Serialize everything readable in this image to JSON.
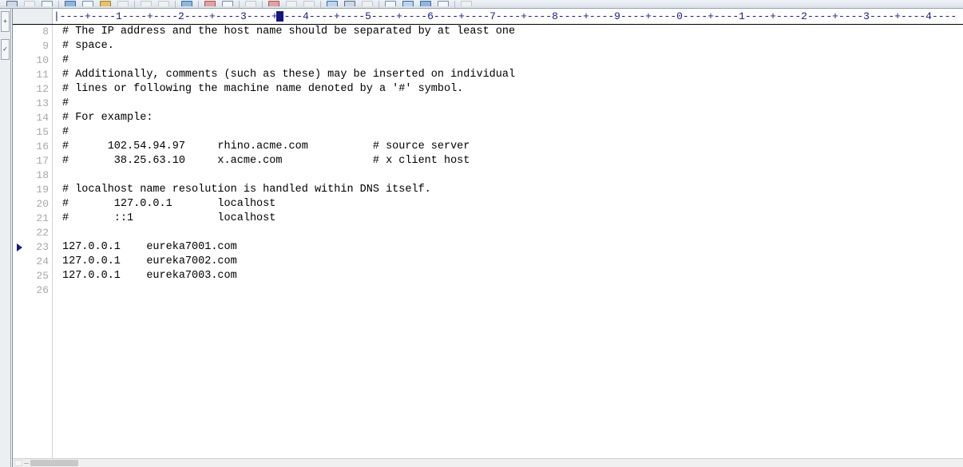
{
  "toolbar": {
    "buttons": [
      {
        "name": "new-file-icon",
        "style": "glyph-dark"
      },
      {
        "name": "open-dropdown-icon",
        "style": "glyph-faint"
      },
      {
        "name": "save-icon",
        "style": "plain"
      },
      {
        "name": "sep",
        "style": "sep"
      },
      {
        "name": "print-icon",
        "style": "glyph-blue"
      },
      {
        "name": "print-preview-icon",
        "style": "plain"
      },
      {
        "name": "folder-icon",
        "style": "glyph-gold"
      },
      {
        "name": "cut-icon",
        "style": "glyph-faint"
      },
      {
        "name": "sep",
        "style": "sep"
      },
      {
        "name": "undo-icon",
        "style": "glyph-faint"
      },
      {
        "name": "redo-icon",
        "style": "glyph-faint"
      },
      {
        "name": "sep",
        "style": "sep"
      },
      {
        "name": "run-icon",
        "style": "glyph-blue"
      },
      {
        "name": "sep",
        "style": "sep"
      },
      {
        "name": "find-icon",
        "style": "glyph-red"
      },
      {
        "name": "replace-icon",
        "style": "plain"
      },
      {
        "name": "sep",
        "style": "sep"
      },
      {
        "name": "indent-icon",
        "style": "glyph-faint"
      },
      {
        "name": "sep",
        "style": "sep"
      },
      {
        "name": "bookmark-icon",
        "style": "glyph-red"
      },
      {
        "name": "word-wrap-icon",
        "style": "glyph-faint"
      },
      {
        "name": "whitespace-icon",
        "style": "glyph-faint"
      },
      {
        "name": "sep",
        "style": "sep"
      },
      {
        "name": "zoom-in-icon",
        "style": "active"
      },
      {
        "name": "zoom-out-icon",
        "style": "glyph-dark"
      },
      {
        "name": "zoom-reset-icon",
        "style": "glyph-faint"
      },
      {
        "name": "sep",
        "style": "sep"
      },
      {
        "name": "view-split-horizontal-icon",
        "style": "plain"
      },
      {
        "name": "view-split-vertical-icon",
        "style": "active"
      },
      {
        "name": "comment-icon",
        "style": "glyph-blue"
      },
      {
        "name": "uncomment-icon",
        "style": "plain"
      },
      {
        "name": "sep",
        "style": "sep"
      },
      {
        "name": "settings-icon",
        "style": "glyph-faint"
      }
    ]
  },
  "left_dock": {
    "tabs": [
      {
        "name": "dock-tab-project",
        "glyph": "+"
      },
      {
        "name": "dock-tab-checked",
        "glyph": "✓"
      }
    ]
  },
  "ruler": {
    "text": "|----+----1----+----2----+----3----+----4----+----5----+----6----+----7----+----8----+----9----+----0----+----1----+----2----+----3----+----4----",
    "caret_column": 27
  },
  "editor": {
    "first_line_number": 8,
    "current_line_number": 23,
    "lines": [
      {
        "n": 8,
        "text": "# The IP address and the host name should be separated by at least one"
      },
      {
        "n": 9,
        "text": "# space."
      },
      {
        "n": 10,
        "text": "#"
      },
      {
        "n": 11,
        "text": "# Additionally, comments (such as these) may be inserted on individual"
      },
      {
        "n": 12,
        "text": "# lines or following the machine name denoted by a '#' symbol."
      },
      {
        "n": 13,
        "text": "#"
      },
      {
        "n": 14,
        "text": "# For example:"
      },
      {
        "n": 15,
        "text": "#"
      },
      {
        "n": 16,
        "text": "#      102.54.94.97     rhino.acme.com          # source server"
      },
      {
        "n": 17,
        "text": "#       38.25.63.10     x.acme.com              # x client host"
      },
      {
        "n": 18,
        "text": ""
      },
      {
        "n": 19,
        "text": "# localhost name resolution is handled within DNS itself."
      },
      {
        "n": 20,
        "text": "#       127.0.0.1       localhost"
      },
      {
        "n": 21,
        "text": "#       ::1             localhost"
      },
      {
        "n": 22,
        "text": ""
      },
      {
        "n": 23,
        "text": "127.0.0.1    eureka7001.com"
      },
      {
        "n": 24,
        "text": "127.0.0.1    eureka7002.com"
      },
      {
        "n": 25,
        "text": "127.0.0.1    eureka7003.com"
      },
      {
        "n": 26,
        "text": ""
      }
    ]
  },
  "scrollbar": {
    "horizontal_thumb_left_pct": 2,
    "horizontal_thumb_width_pct": 5
  },
  "colors": {
    "ruler_text": "#1a1a8c",
    "caret_marker": "#151580",
    "line_number": "#a8a8a8",
    "code_text": "#000000",
    "gutter_bg": "#ffffff",
    "editor_bg": "#ffffff"
  }
}
